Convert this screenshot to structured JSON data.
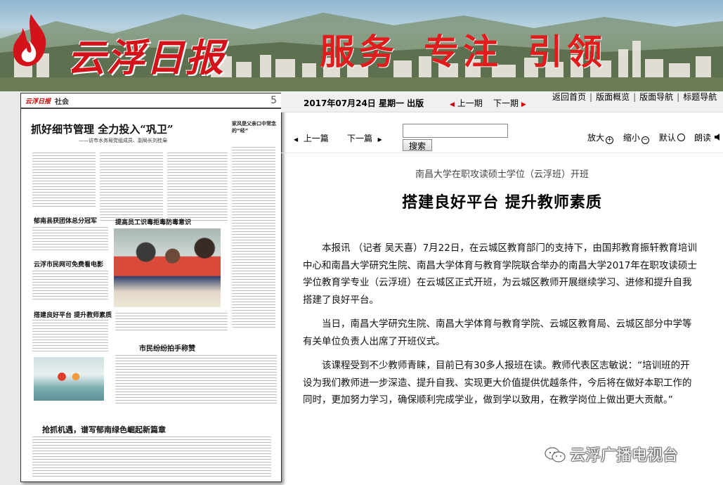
{
  "banner": {
    "logo_text": "云浮日报",
    "slogan": [
      "服务",
      "专注",
      "引领"
    ]
  },
  "paper_page": {
    "section": "社会",
    "page_number": "5",
    "main_title": "抓好细节管理  全力投入“巩卫”",
    "main_subtitle": "——访市水务局党组成员、副局长刘桂枭",
    "side_title": "家风是父亲口中常念的“经”",
    "headlines": [
      "郁南县获团体总分冠军",
      "提高员工识毒拒毒防毒意识",
      "云浮市民网可免费看电影",
      "搭建良好平台  提升教师素质",
      "市民纷纷拍手称赞",
      "抢抓机遇，谱写郁南绿色崛起新篇章"
    ]
  },
  "topbar": {
    "date": "2017年07月24日  星期一  出版",
    "prev_issue": "上一期",
    "next_issue": "下一期",
    "links": [
      "返回首页",
      "版面概览",
      "版面导航",
      "标题导航"
    ]
  },
  "toolbar": {
    "prev": "上一篇",
    "next": "下一篇",
    "search_value": "",
    "search_button": "搜索",
    "zoom_in": "放大",
    "zoom_out": "缩小",
    "zoom_default": "默认",
    "read_aloud": "朗读"
  },
  "article": {
    "intro_title": "南昌大学在职攻读硕士学位（云浮班）开班",
    "title": "搭建良好平台  提升教师素质",
    "paragraphs": [
      "本报讯 （记者 吴天喜）7月22日，在云城区教育部门的支持下，由国邦教育振轩教育培训中心和南昌大学研究生院、南昌大学体育与教育学院联合举办的南昌大学2017年在职攻读硕士学位教育学专业（云浮班）在云城区正式开班，为云城区教师开展继续学习、进修和提升自我搭建了良好平台。",
      "当日，南昌大学研究生院、南昌大学体育与教育学院、云城区教育局、云城区部分中学等有关单位负责人出席了开班仪式。",
      "该课程受到不少教师青睐，目前已有30多人报班在读。教师代表区志敏说：“培训班的开设为我们教师进一步深造、提升自我、实现更大价值提供优越条件，今后将在做好本职工作的同时，更加努力学习，确保顺利完成学业，做到学以致用，在教学岗位上做出更大贡献。”"
    ]
  },
  "watermark": "云浮广播电视台"
}
